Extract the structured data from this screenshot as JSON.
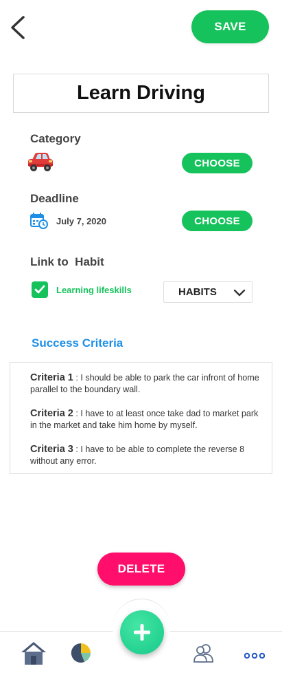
{
  "header": {
    "save_label": "SAVE"
  },
  "goal": {
    "title": "Learn Driving"
  },
  "category": {
    "label": "Category",
    "icon": "red-car-icon",
    "choose_label": "CHOOSE"
  },
  "deadline": {
    "label": "Deadline",
    "date": "July 7, 2020",
    "icon": "calendar-icon",
    "choose_label": "CHOOSE"
  },
  "habit": {
    "label": "Link to  Habit",
    "checked": true,
    "linked_habit": "Learning lifeskills",
    "dropdown_value": "HABITS"
  },
  "success_criteria": {
    "title": "Success Criteria",
    "items": [
      {
        "label": "Criteria 1",
        "text": "I should be able to park the car infront of home parallel to the boundary wall."
      },
      {
        "label": "Criteria 2",
        "text": "I have to at least once take dad to market park in the market and take him home by myself."
      },
      {
        "label": "Criteria 3",
        "text": "I have to be able to complete the reverse 8 without any error."
      }
    ]
  },
  "delete_label": "DELETE",
  "nav": {
    "items": [
      "home-icon",
      "pie-chart-icon",
      "add-icon",
      "users-icon",
      "more-icon"
    ]
  },
  "colors": {
    "primary_green": "#16c25c",
    "delete_pink": "#ff0f6b",
    "link_blue": "#1e8fe6",
    "fab_green": "#2dd896"
  }
}
